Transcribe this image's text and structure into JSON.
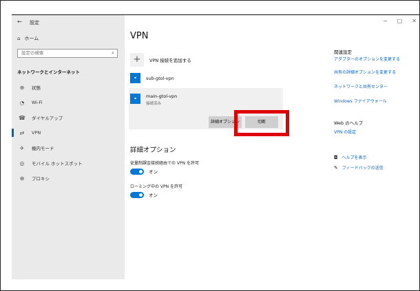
{
  "sidebar": {
    "window_title": "設定",
    "home": "ホーム",
    "search_placeholder": "設定の検索",
    "section": "ネットワークとインターネット",
    "items": [
      {
        "label": "状態",
        "icon": "globe-status-icon"
      },
      {
        "label": "Wi-Fi",
        "icon": "wifi-icon"
      },
      {
        "label": "ダイヤルアップ",
        "icon": "dialup-icon"
      },
      {
        "label": "VPN",
        "icon": "vpn-icon",
        "selected": true
      },
      {
        "label": "機内モード",
        "icon": "airplane-icon"
      },
      {
        "label": "モバイル ホットスポット",
        "icon": "hotspot-icon"
      },
      {
        "label": "プロキシ",
        "icon": "globe-icon"
      }
    ]
  },
  "main": {
    "title": "VPN",
    "add_vpn": "VPN 接続を追加する",
    "connections": [
      {
        "name": "sub-gtol-vpn",
        "status": ""
      },
      {
        "name": "main-gtol-vpn",
        "status": "接続済み"
      }
    ],
    "buttons": {
      "advanced": "詳細オプション",
      "disconnect": "切断"
    },
    "advanced_title": "詳細オプション",
    "options": [
      {
        "label": "従量制課金接続経由での VPN を許可",
        "state": "オン"
      },
      {
        "label": "ローミング中の VPN を許可",
        "state": "オン"
      }
    ]
  },
  "related": {
    "title": "関連設定",
    "links": [
      "アダプターのオプションを変更する",
      "共有の詳細オプションを変更する",
      "ネットワークと共有センター",
      "Windows ファイアウォール"
    ]
  },
  "web_help": {
    "title": "Web のヘルプ",
    "link": "VPN の設定"
  },
  "help_links": {
    "help": "ヘルプを表示",
    "feedback": "フィードバックの送信"
  },
  "colors": {
    "accent": "#0078d7",
    "highlight": "#e00000",
    "sidebar_bg": "#eaeaea"
  }
}
